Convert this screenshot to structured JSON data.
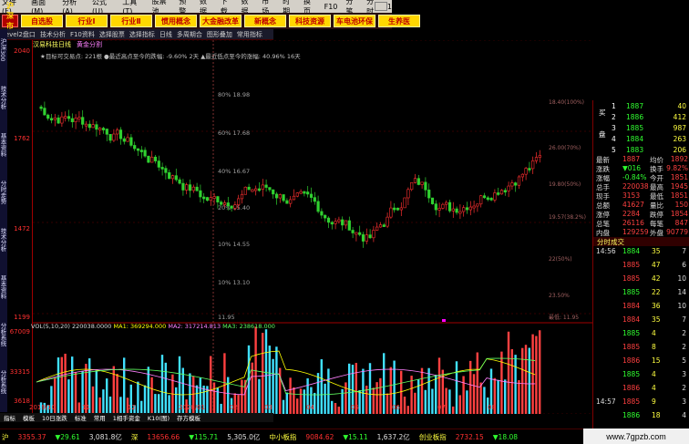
{
  "menu": [
    "文件(F)",
    "画面(M)",
    "分析(A)",
    "公式(U)",
    "工具(T)",
    "股票池",
    "预警",
    "数据",
    "下载",
    "数据",
    "市场",
    "时期",
    "换页",
    "F10",
    "分笔",
    "分时",
    "1"
  ],
  "market_button": "沪深市场",
  "quick_buttons": [
    "自选股",
    "行业Ⅰ",
    "行业Ⅱ",
    "惯用概念",
    "大金融改革",
    "新概念",
    "科技资源",
    "车电池环保",
    "生养医"
  ],
  "toolbar": [
    "Level2盘口",
    "技术分析",
    "F10资料",
    "选择股票",
    "选择指标",
    "日线",
    "多周期合",
    "图形叠加",
    "常用指标"
  ],
  "stock_title": "汉易科技日线",
  "stock_subtitle": "黄金分割",
  "legend_line": "★目标可交易点: 221根   ●最近高点至今的跌幅: -9.60%  2天  ▲最近低点至今的涨幅: 40.96%  16天",
  "y_axis_labels": [
    "2040",
    "1762",
    "1472",
    "1199",
    "67009",
    "33315",
    "3618"
  ],
  "fib_labels": [
    "80%  18.98",
    "60%  17.68",
    "40%  16.67",
    "20%  15.40",
    "10%  14.55",
    "10%  13.10",
    "11.95"
  ],
  "right_fib": [
    "18.40(100%)",
    "26.00(70%)",
    "19.80(50%)",
    "19.57(38.2%)",
    "22(50%)",
    "23.50%",
    "最低: 11.95"
  ],
  "vol_line": {
    "a": "VOL(5,10,20) 220038.0000",
    "b": "MA1: 369294.000",
    "c": "MA2: 317214.813",
    "d": "MA3: 238618.000"
  },
  "date_axis": [
    "2019/10",
    "11",
    "12",
    "2020/01",
    "02",
    "03",
    "04",
    "05",
    "06",
    "07",
    "08"
  ],
  "bottom_tabs": [
    "指标",
    "模板",
    "10日涨跌",
    "标准",
    "常用",
    "1相手资金",
    "K10(图)",
    "存方模板"
  ],
  "left_tabs": [
    "沪深300",
    "技术分析",
    "基本资料",
    "分时走势",
    "技术分析",
    "基本资料",
    "分析系统",
    "分析系统"
  ],
  "order_book": {
    "buy_label": "买",
    "side_label": "盘",
    "rows": [
      {
        "n": "1",
        "price": "1887",
        "qty": "40"
      },
      {
        "n": "2",
        "price": "1886",
        "qty": "412"
      },
      {
        "n": "3",
        "price": "1885",
        "qty": "987"
      },
      {
        "n": "4",
        "price": "1884",
        "qty": "263"
      },
      {
        "n": "5",
        "price": "1883",
        "qty": "206"
      }
    ]
  },
  "quote": [
    {
      "k": "最新",
      "v": "1887",
      "k2": "均价",
      "v2": "1892"
    },
    {
      "k": "涨跌",
      "v": "▼016",
      "k2": "换手",
      "v2": "9.82%"
    },
    {
      "k": "涨幅",
      "v": "-0.84%",
      "k2": "今开",
      "v2": "1851"
    },
    {
      "k": "总手",
      "v": "220038",
      "k2": "最高",
      "v2": "1945"
    },
    {
      "k": "现手",
      "v": "3153",
      "k2": "最低",
      "v2": "1851"
    },
    {
      "k": "总额",
      "v": "41627",
      "k2": "量比",
      "v2": "150"
    },
    {
      "k": "涨停",
      "v": "2284",
      "k2": "跌停",
      "v2": "1854"
    },
    {
      "k": "总笔",
      "v": "26116",
      "k2": "每笔",
      "v2": "847"
    },
    {
      "k": "内盘",
      "v": "129259",
      "k2": "外盘",
      "v2": "90779"
    }
  ],
  "ticks_header": "分时成交",
  "ticks": [
    {
      "t": "14:56",
      "p": "1884",
      "q": "35",
      "a": "7"
    },
    {
      "t": "",
      "p": "1885",
      "q": "47",
      "a": "6"
    },
    {
      "t": "",
      "p": "1885",
      "q": "42",
      "a": "10"
    },
    {
      "t": "",
      "p": "1885",
      "q": "22",
      "a": "14"
    },
    {
      "t": "",
      "p": "1884",
      "q": "36",
      "a": "10"
    },
    {
      "t": "",
      "p": "1884",
      "q": "35",
      "a": "7"
    },
    {
      "t": "",
      "p": "1885",
      "q": "4",
      "a": "2"
    },
    {
      "t": "",
      "p": "1885",
      "q": "8",
      "a": "2"
    },
    {
      "t": "",
      "p": "1886",
      "q": "15",
      "a": "5"
    },
    {
      "t": "",
      "p": "1885",
      "q": "4",
      "a": "3"
    },
    {
      "t": "",
      "p": "1886",
      "q": "4",
      "a": "2"
    },
    {
      "t": "14:57",
      "p": "1885",
      "q": "9",
      "a": "3"
    },
    {
      "t": "",
      "p": "1886",
      "q": "18",
      "a": "4"
    }
  ],
  "ticker": [
    {
      "t": "沪",
      "c": "tk-yel"
    },
    {
      "t": "3355.37",
      "c": "tk-red"
    },
    {
      "t": "▼29.61",
      "c": "tk-green"
    },
    {
      "t": "3,081.8亿",
      "c": "tk-white"
    },
    {
      "t": "深",
      "c": "tk-yel"
    },
    {
      "t": "13656.66",
      "c": "tk-red"
    },
    {
      "t": "▼115.71",
      "c": "tk-green"
    },
    {
      "t": "5,305.0亿",
      "c": "tk-white"
    },
    {
      "t": "中小板指",
      "c": "tk-yel"
    },
    {
      "t": "9084.62",
      "c": "tk-red"
    },
    {
      "t": "▼15.11",
      "c": "tk-green"
    },
    {
      "t": "1,637.2亿",
      "c": "tk-white"
    },
    {
      "t": "创业板指",
      "c": "tk-yel"
    },
    {
      "t": "2732.15",
      "c": "tk-red"
    },
    {
      "t": "▼18.08",
      "c": "tk-green"
    }
  ],
  "watermark": "www.7gpzb.com",
  "colors": {
    "up": "#ff3030",
    "down": "#30ff30",
    "axis": "#a00000",
    "volume_up": "#ff4040",
    "volume_down": "#40e0ff"
  }
}
